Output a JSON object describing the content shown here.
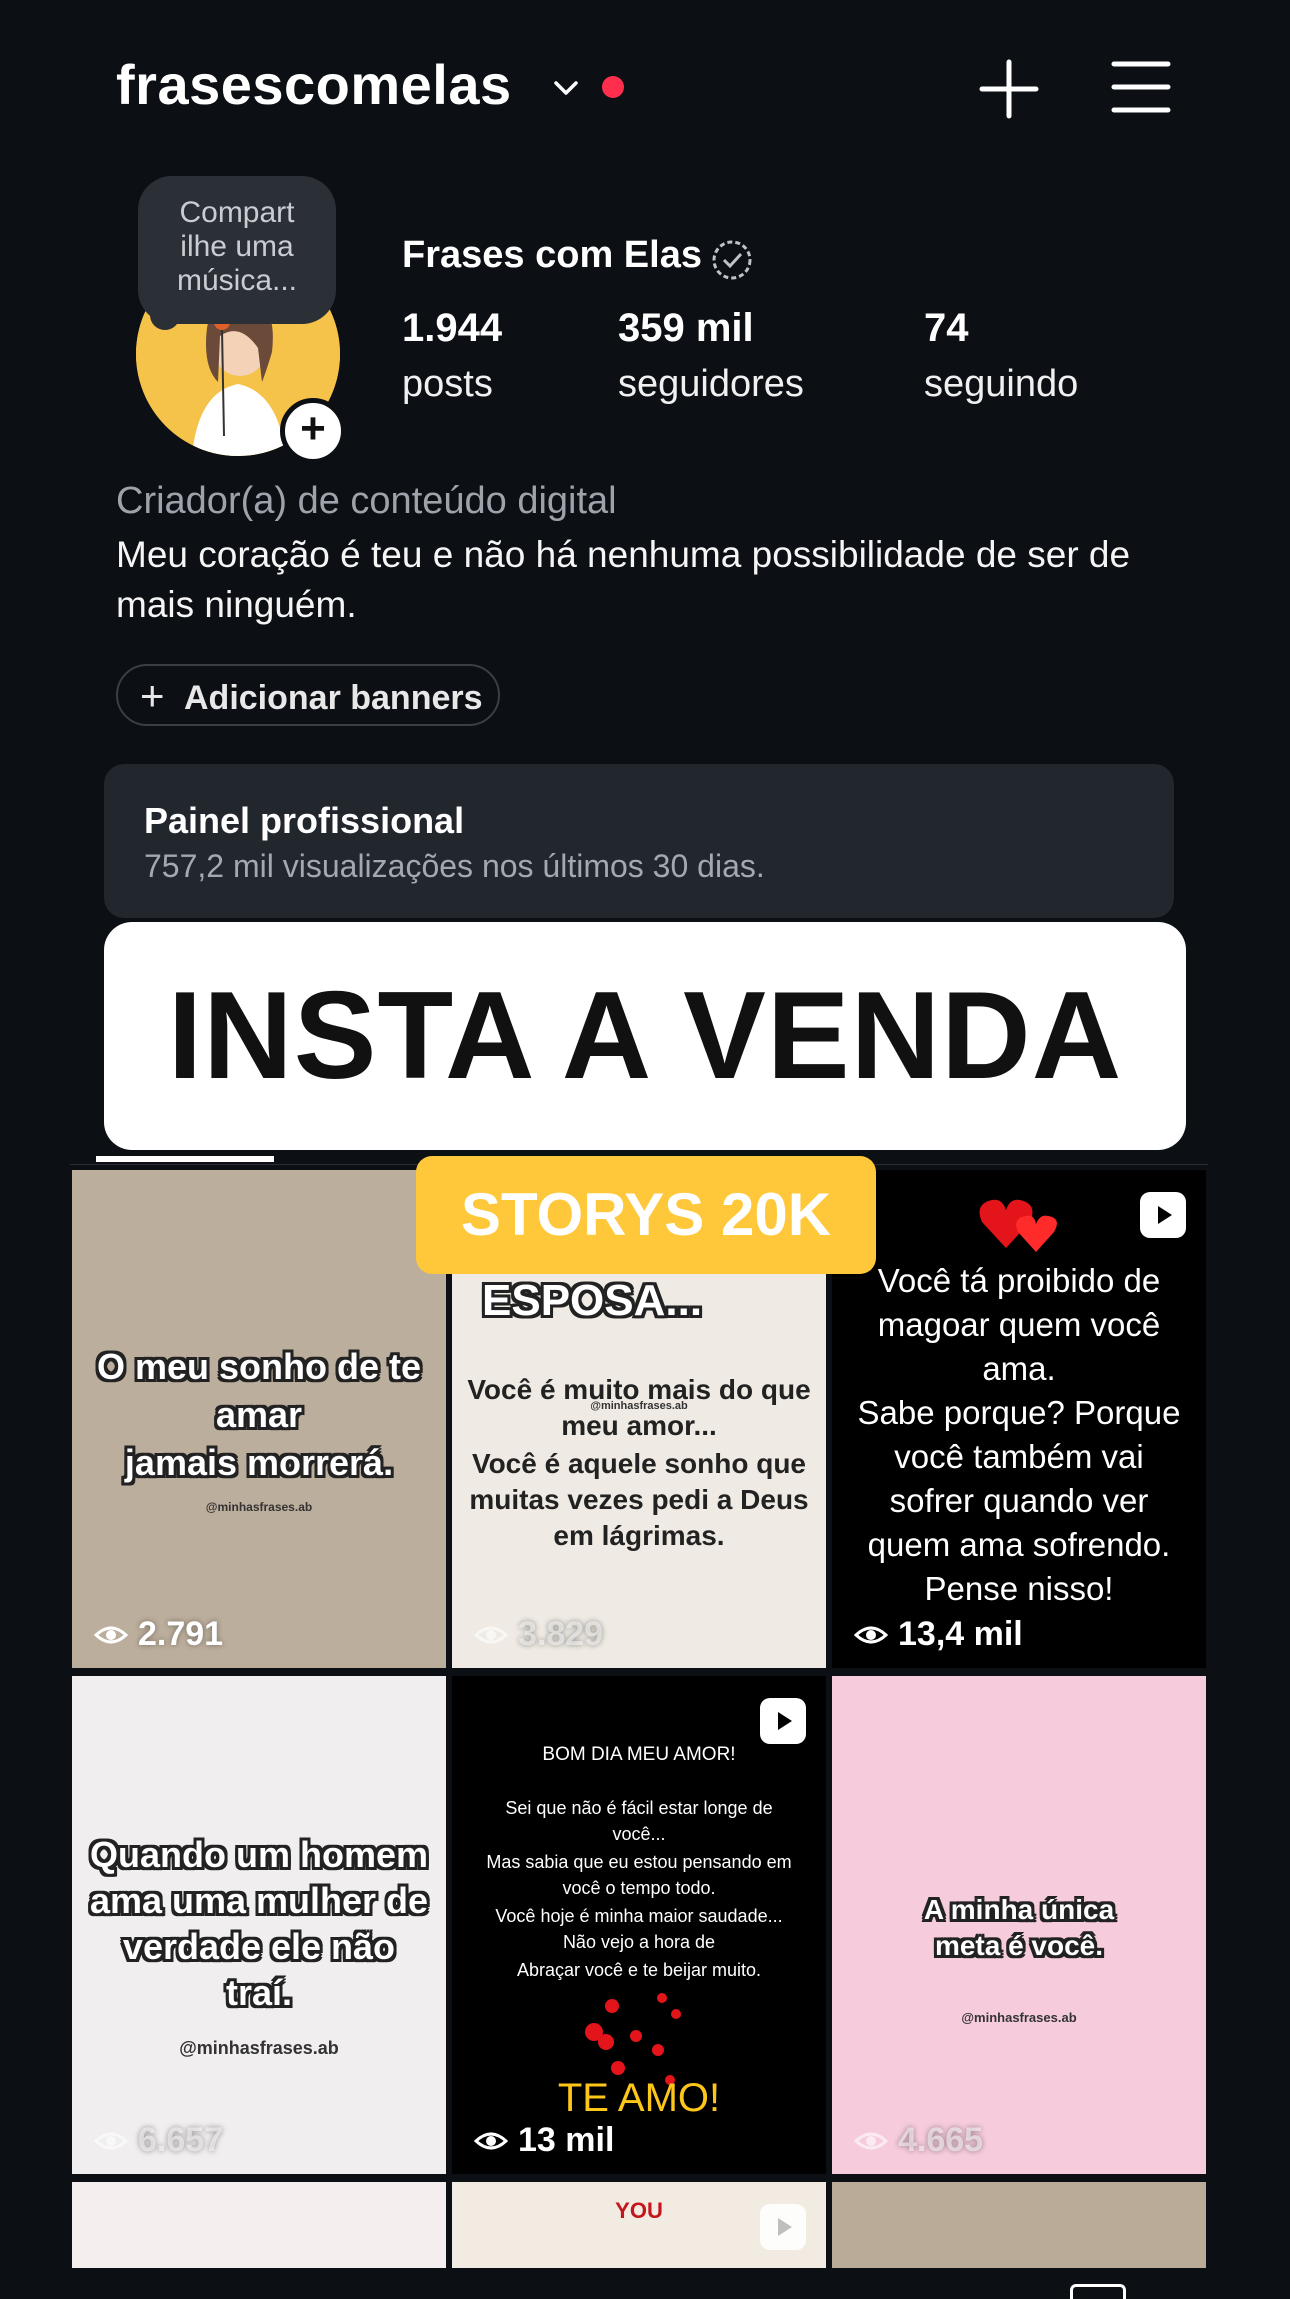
{
  "header": {
    "username": "frasescomelas",
    "icons": {
      "dropdown": "chevron-down-icon",
      "new_post": "plus-icon",
      "menu": "hamburger-menu-icon"
    }
  },
  "profile": {
    "note": "Compart\nilhe uma\nmúsica...",
    "display_name": "Frases com Elas",
    "stats": [
      {
        "value": "1.944",
        "label": "posts"
      },
      {
        "value": "359 mil",
        "label": "seguidores"
      },
      {
        "value": "74",
        "label": "seguindo"
      }
    ],
    "category": "Criador(a) de conteúdo digital",
    "bio": "Meu coração é teu  e não há nenhuma possibilidade de ser de mais ninguém.",
    "add_banners": "Adicionar banners"
  },
  "professional_panel": {
    "title": "Painel profissional",
    "subtitle": "757,2 mil visualizações nos últimos 30 dias."
  },
  "overlays": {
    "sale_banner": "INSTA A VENDA",
    "storys_tag": "STORYS 20K"
  },
  "posts": [
    {
      "lines": [
        "O meu sonho de te",
        "amar",
        "jamais morrerá."
      ],
      "handle": "@minhasfrases.ab",
      "views": "2.791"
    },
    {
      "top": "ESPOSA...",
      "lines": [
        "Você é muito mais do que",
        "meu amor...",
        "Você é aquele sonho que",
        "muitas vezes pedi a Deus",
        "em lágrimas."
      ],
      "handle": "@minhasfrases.ab",
      "views": "3.829"
    },
    {
      "lines": [
        "Você tá proibido de",
        "magoar quem você",
        "ama.",
        "Sabe porque? Porque",
        "você também vai",
        "sofrer quando ver",
        "quem ama sofrendo.",
        "Pense nisso!"
      ],
      "views": "13,4 mil",
      "reel": true
    },
    {
      "lines": [
        "Quando um homem",
        "ama uma mulher de",
        "verdade ele não",
        "traí."
      ],
      "handle": "@minhasfrases.ab",
      "views": "6.657"
    },
    {
      "top": "BOM DIA MEU AMOR!",
      "lines": [
        "Sei que não é fácil estar longe de",
        "você...",
        "Mas sabia que eu estou pensando em",
        "você o tempo todo.",
        "Você hoje é minha maior saudade...",
        "Não vejo a hora de",
        "Abraçar você e te beijar muito."
      ],
      "bottom": "TE AMO!",
      "views": "13 mil",
      "reel": true
    },
    {
      "lines": [
        "A minha única",
        "meta é você."
      ],
      "handle": "@minhasfrases.ab",
      "views": "4.665"
    }
  ],
  "partial_row": {
    "word": "YOU"
  },
  "colors": {
    "background": "#0c0f14",
    "accent_red": "#ff2e4d",
    "storys_yellow": "#ffc83a",
    "panel": "#22262d"
  }
}
